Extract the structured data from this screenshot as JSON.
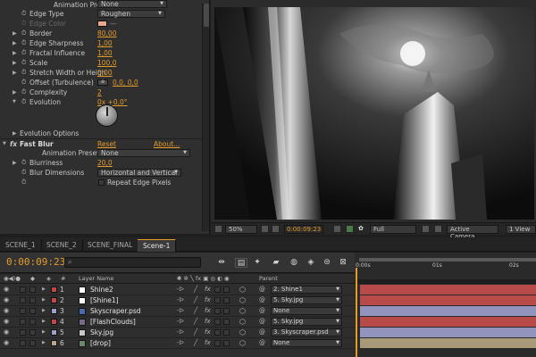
{
  "effects": {
    "animation_presets_top": {
      "label": "Animation Presets:",
      "value": "None"
    },
    "edge_type": {
      "label": "Edge Type",
      "value": "Roughen"
    },
    "edge_color": {
      "label": "Edge Color",
      "swatch": "#e8a890"
    },
    "border": {
      "label": "Border",
      "value": "80,00"
    },
    "edge_sharpness": {
      "label": "Edge Sharpness",
      "value": "1,00"
    },
    "fractal_influence": {
      "label": "Fractal Influence",
      "value": "1,00"
    },
    "scale": {
      "label": "Scale",
      "value": "100,0"
    },
    "stretch": {
      "label": "Stretch Width or Heigh",
      "value": "0,00"
    },
    "offset": {
      "label": "Offset (Turbulence)",
      "value": "0,0, 0,0"
    },
    "complexity": {
      "label": "Complexity",
      "value": "2"
    },
    "evolution": {
      "label": "Evolution",
      "value": "0x +0,0°"
    },
    "evolution_options": {
      "label": "Evolution Options"
    },
    "fast_blur": {
      "label": "Fast Blur",
      "reset": "Reset",
      "about": "About..."
    },
    "fb_presets": {
      "label": "Animation Presets:",
      "value": "None"
    },
    "blurriness": {
      "label": "Blurriness",
      "value": "20,0"
    },
    "blur_dimensions": {
      "label": "Blur Dimensions",
      "value": "Horizontal and Vertical"
    },
    "repeat_edge": {
      "label": "Repeat Edge Pixels"
    }
  },
  "viewer": {
    "zoom": "50%",
    "timecode": "0:00:09:23",
    "resolution": "Full",
    "camera": "Active Camera",
    "views": "1 View"
  },
  "tabs": [
    "SCENE_1",
    "SCENE_2",
    "SCENE_FINAL",
    "Scene-1"
  ],
  "active_tab": 3,
  "timeline": {
    "timecode": "0:00:09:23",
    "ruler": [
      "0:00s",
      "01s",
      "02s"
    ],
    "columns": {
      "layer_name": "Layer Name",
      "parent": "Parent"
    },
    "layers": [
      {
        "num": "1",
        "name": "Shine2",
        "label_color": "#c04848",
        "icon_color": "#ffffff",
        "parent": "2. Shine1",
        "bar_color": "#b84a4a"
      },
      {
        "num": "2",
        "name": "[Shine1]",
        "label_color": "#c04848",
        "icon_color": "#ffffff",
        "parent": "5. Sky.jpg",
        "bar_color": "#b84a4a"
      },
      {
        "num": "3",
        "name": "Skyscraper.psd",
        "label_color": "#9fa0c8",
        "icon_color": "#4a6ab0",
        "parent": "None",
        "bar_color": "#9394bd"
      },
      {
        "num": "4",
        "name": "[FlashClouds]",
        "label_color": "#c04848",
        "icon_color": "#7a6a8a",
        "parent": "5. Sky.jpg",
        "bar_color": "#b84a4a"
      },
      {
        "num": "5",
        "name": "Sky.jpg",
        "label_color": "#9fa0c8",
        "icon_color": "#c8c8c8",
        "parent": "3. Skyscraper.psd",
        "bar_color": "#9394bd"
      },
      {
        "num": "6",
        "name": "[drop]",
        "label_color": "#b8a888",
        "icon_color": "#6a8a6a",
        "parent": "None",
        "bar_color": "#a89a78"
      }
    ]
  },
  "colors": {
    "accent": "#e59b2a"
  }
}
